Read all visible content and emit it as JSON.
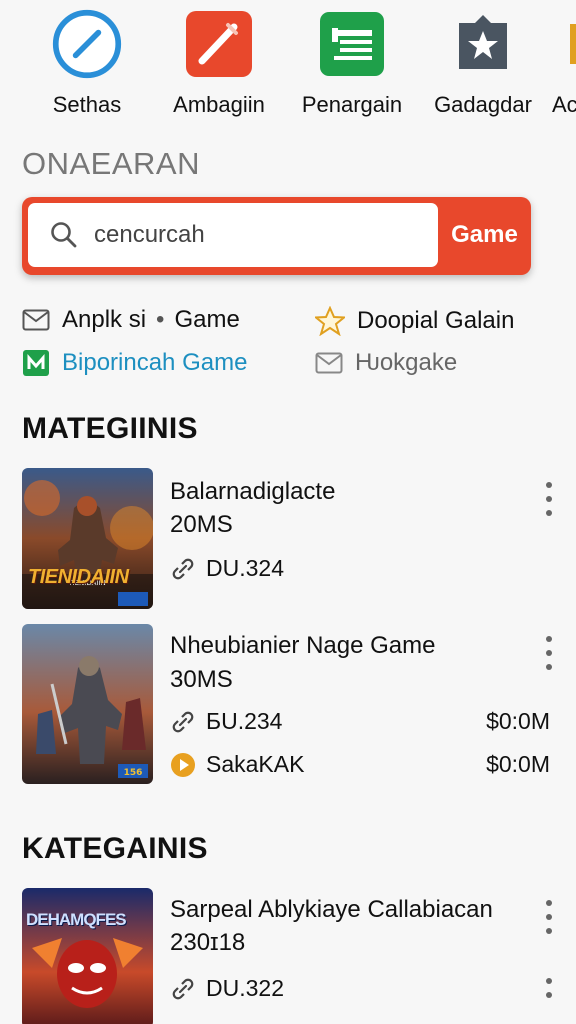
{
  "apps": [
    {
      "label": "Sethas",
      "icon": "slash-circle-icon",
      "color": "#2a8fd8"
    },
    {
      "label": "Ambagiin",
      "icon": "pencil-icon",
      "color": "#e8482c"
    },
    {
      "label": "Penargain",
      "icon": "document-list-icon",
      "color": "#1fa04a"
    },
    {
      "label": "Gadagdar",
      "icon": "star-badge-icon",
      "color": "#4a5561"
    },
    {
      "label": "Ac",
      "icon": "partial-app-icon",
      "color": "#e0a020"
    }
  ],
  "section_caption": "ONAEARAN",
  "search": {
    "value": "cencurcah",
    "button_label": "Game",
    "accent": "#e8482c"
  },
  "filters": {
    "row1_left_a": "Anplk si",
    "row1_left_b": "Game",
    "row1_right": "Doopial Galain",
    "row2_left": "Biporincah Game",
    "row2_right": "Ƕokgake"
  },
  "headings": {
    "first": "MATEGIINIS",
    "second": "KATEGAINIS"
  },
  "items": [
    {
      "title": "Balarnadiglacte",
      "meta": "20MS",
      "stat": "DU.324",
      "thumb_text": "TIENIDAIIN"
    },
    {
      "title": "Nheubianier Nage Game",
      "meta": "30MS",
      "stat": "БU.234",
      "price1": "$0:0M",
      "publisher": "SakaKAK",
      "price2": "$0:0M"
    },
    {
      "title": "Sarpeal Ablykiaye Callabiacan",
      "meta": "230ɪ18",
      "stat": "DU.322",
      "thumb_text": "DEHAMQFES"
    }
  ]
}
